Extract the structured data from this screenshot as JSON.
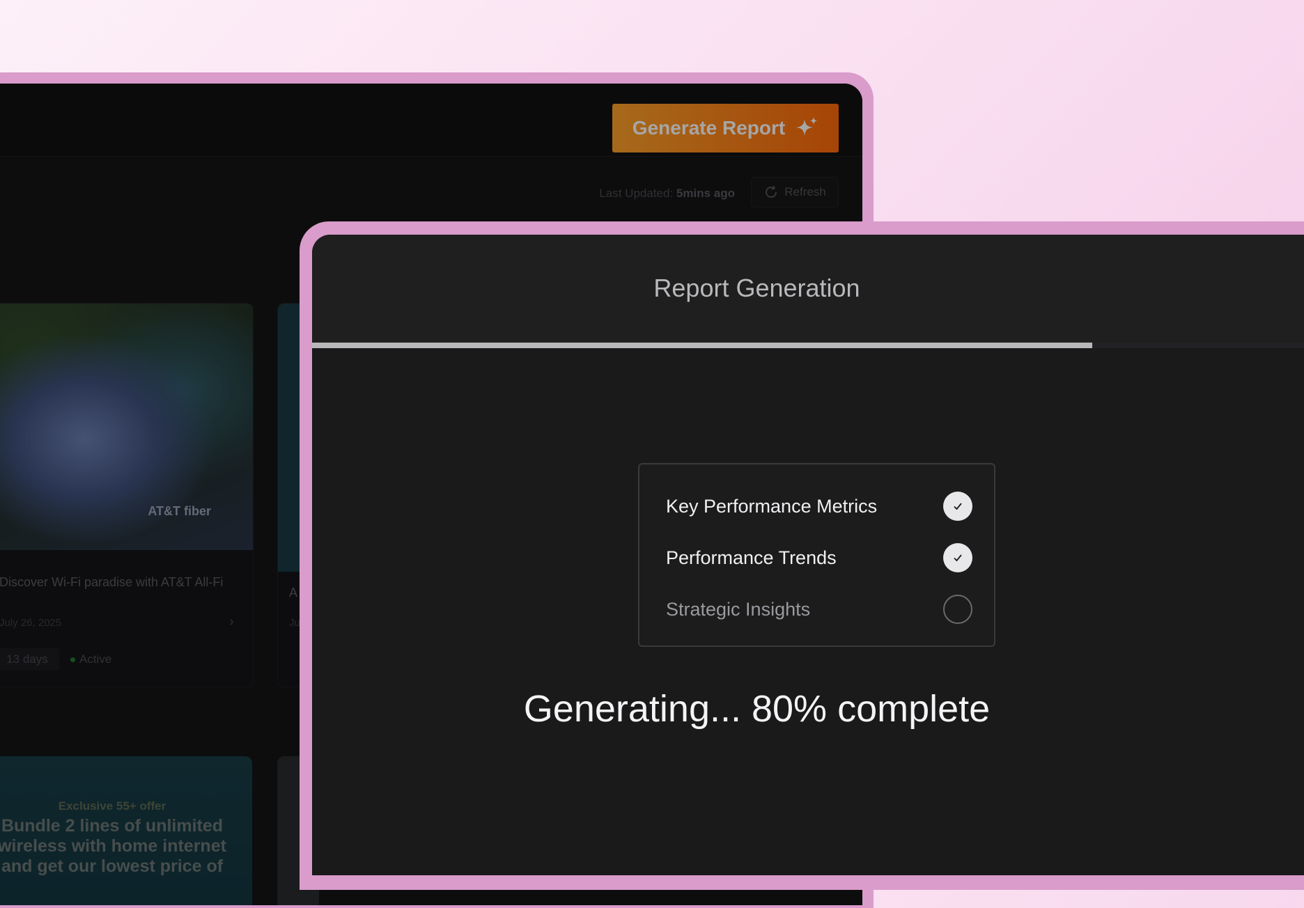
{
  "back_window": {
    "generate_button": "Generate Report",
    "last_updated_label": "Last Updated:",
    "last_updated_value": "5mins ago",
    "refresh_button": "Refresh",
    "campaign_card": {
      "logo": "AT&T fiber",
      "title": "Discover Wi-Fi paradise with AT&T All-Fi",
      "date": "July 26, 2025",
      "duration_badge": "13 days",
      "status_badge": "Active"
    },
    "second_card_peek": {
      "title_fragment": "A",
      "date_fragment": "Ju"
    },
    "promo_card": {
      "kicker": "Exclusive 55+ offer",
      "headline": "Bundle 2 lines of unlimited wireless with home internet and get our lowest price of"
    }
  },
  "report_dialog": {
    "title": "Report Generation",
    "progress_percent": 80,
    "checklist": [
      {
        "label": "Key Performance Metrics",
        "done": true
      },
      {
        "label": "Performance Trends",
        "done": true
      },
      {
        "label": "Strategic Insights",
        "done": false
      }
    ],
    "status": "Generating... 80% complete"
  },
  "colors": {
    "accent_orange_start": "#ffa22a",
    "accent_orange_end": "#ff6a0a",
    "frame_pink": "#d99ccb",
    "dialog_bg": "#1a1a1b"
  },
  "icons": {
    "generate": "sparkle-icon",
    "refresh": "refresh-icon",
    "done": "check-icon",
    "card_next": "chevron-right-icon"
  }
}
